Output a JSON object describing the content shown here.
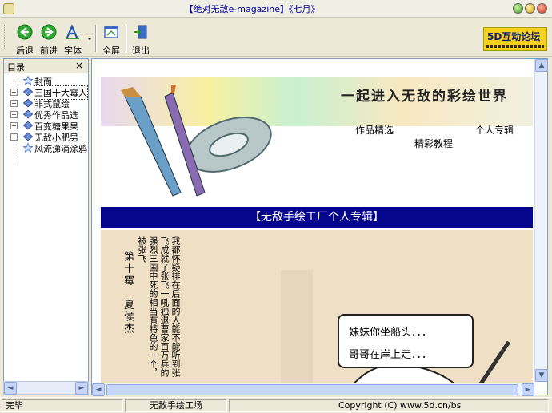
{
  "window": {
    "title": "【绝对无敌e-magazine】《七月》"
  },
  "toolbar": {
    "back_label": "后退",
    "forward_label": "前进",
    "font_label": "字体",
    "fullscreen_label": "全屏",
    "exit_label": "退出",
    "logo_text": "5D互动论坛"
  },
  "sidebar": {
    "title": "目录",
    "close_glyph": "×",
    "items": [
      {
        "label": "封面",
        "expandable": false,
        "icon": "star-icon"
      },
      {
        "label": "三国十大霉人",
        "expandable": true,
        "icon": "book-icon"
      },
      {
        "label": "非式鼠绘",
        "expandable": true,
        "icon": "book-icon"
      },
      {
        "label": "优秀作品选",
        "expandable": true,
        "icon": "book-icon"
      },
      {
        "label": "百变糖果果",
        "expandable": true,
        "icon": "book-icon"
      },
      {
        "label": "无敌小肥男",
        "expandable": true,
        "icon": "book-icon"
      },
      {
        "label": "风流涕淌涂鸦",
        "expandable": false,
        "icon": "star-icon"
      }
    ]
  },
  "content": {
    "banner": {
      "slogan": "一起进入无敌的彩绘世界",
      "menu_works": "作品精选",
      "menu_tutorials": "精彩教程",
      "menu_personal": "个人专辑"
    },
    "section_title": "【无敌手绘工厂个人专辑】",
    "article": {
      "chapter": "第十霉　夏侯杰",
      "column_text": "我都怀疑排在后面的人能不能听到张飞成就了张飞一吼独退曹家百万兵的强烈三国中死的相当有特色的一个，被张飞",
      "speech_line1": "妹妹你坐船头．．．",
      "speech_line2": "哥哥在岸上走．．．"
    }
  },
  "statusbar": {
    "status": "完毕",
    "site": "无敌手绘工场",
    "copyright": "Copyright (C) www.5d.cn/bs"
  },
  "colors": {
    "section_bar": "#06068c",
    "article_bg": "#efdfc4",
    "scrollbar": "#c6d6fa"
  }
}
